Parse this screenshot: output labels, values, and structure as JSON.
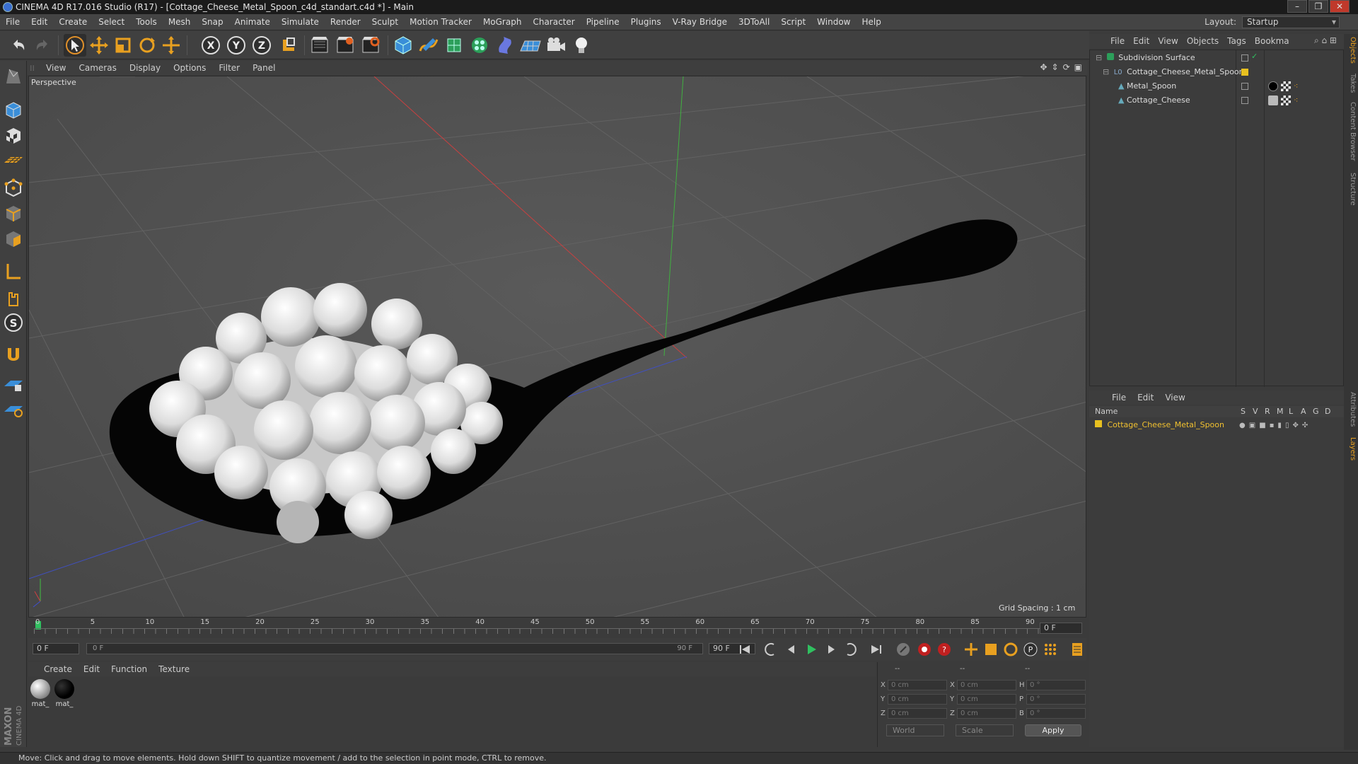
{
  "window": {
    "title": "CINEMA 4D R17.016 Studio (R17) - [Cottage_Cheese_Metal_Spoon_c4d_standart.c4d *] - Main",
    "controls": [
      "–",
      "❐",
      "✕"
    ]
  },
  "menubar": {
    "items": [
      "File",
      "Edit",
      "Create",
      "Select",
      "Tools",
      "Mesh",
      "Snap",
      "Animate",
      "Simulate",
      "Render",
      "Sculpt",
      "Motion Tracker",
      "MoGraph",
      "Character",
      "Pipeline",
      "Plugins",
      "V-Ray Bridge",
      "3DToAll",
      "Script",
      "Window",
      "Help"
    ],
    "layout_label": "Layout:",
    "layout_value": "Startup"
  },
  "toolbar": {
    "icons": [
      "undo-icon",
      "redo-icon",
      "select-arrow-icon",
      "move-icon",
      "scale-icon",
      "rotate-icon",
      "multi-transform-icon",
      "x-axis-icon",
      "y-axis-icon",
      "z-axis-icon",
      "world-coordinate-icon",
      "render-view-icon",
      "render-picture-viewer-icon",
      "render-settings-icon",
      "cube-icon",
      "pen-spline-icon",
      "subdivision-icon",
      "cloner-icon",
      "deformer-icon",
      "floor-icon",
      "camera-icon",
      "light-icon"
    ],
    "axis_labels": [
      "X",
      "Y",
      "Z"
    ]
  },
  "left_toolbar": {
    "icons": [
      "make-editable-icon",
      "model-mode-icon",
      "texture-mode-icon",
      "workplane-icon",
      "points-mode-icon",
      "edges-mode-icon",
      "polygons-mode-icon",
      "axis-mode-icon",
      "tweak-mode-icon",
      "solo-icon",
      "snap-icon",
      "lock-workplane-icon",
      "planar-workplane-icon"
    ],
    "solo_label": "S"
  },
  "viewport": {
    "menu": [
      "View",
      "Cameras",
      "Display",
      "Options",
      "Filter",
      "Panel"
    ],
    "label": "Perspective",
    "grid_spacing": "Grid Spacing : 1 cm"
  },
  "timeline": {
    "ticks": [
      "0",
      "5",
      "10",
      "15",
      "20",
      "25",
      "30",
      "35",
      "40",
      "45",
      "50",
      "55",
      "60",
      "65",
      "70",
      "75",
      "80",
      "85",
      "90"
    ],
    "current_frame": "0 F",
    "start_field": "0 F",
    "range_start": "0 F",
    "range_end": "90 F",
    "end_field": "90 F"
  },
  "material_manager": {
    "menu": [
      "Create",
      "Edit",
      "Function",
      "Texture"
    ],
    "materials": [
      {
        "name": "mat_"
      },
      {
        "name": "mat_"
      }
    ]
  },
  "coordinates": {
    "header": [
      "--",
      "--",
      "--"
    ],
    "rows": [
      {
        "a_label": "X",
        "a_val": "0 cm",
        "b_label": "X",
        "b_val": "0 cm",
        "c_label": "H",
        "c_val": "0 °"
      },
      {
        "a_label": "Y",
        "a_val": "0 cm",
        "b_label": "Y",
        "b_val": "0 cm",
        "c_label": "P",
        "c_val": "0 °"
      },
      {
        "a_label": "Z",
        "a_val": "0 cm",
        "b_label": "Z",
        "b_val": "0 cm",
        "c_label": "B",
        "c_val": "0 °"
      }
    ],
    "space": "World",
    "mode": "Scale",
    "apply_label": "Apply"
  },
  "object_manager": {
    "menu": [
      "File",
      "Edit",
      "View",
      "Objects",
      "Tags",
      "Bookma"
    ],
    "objects": [
      {
        "name": "Subdivision Surface",
        "indent": 0
      },
      {
        "name": "Cottage_Cheese_Metal_Spoon",
        "indent": 1
      },
      {
        "name": "Metal_Spoon",
        "indent": 2
      },
      {
        "name": "Cottage_Cheese",
        "indent": 2
      }
    ]
  },
  "layer_manager": {
    "menu": [
      "File",
      "Edit",
      "View"
    ],
    "columns": [
      "Name",
      "S",
      "V",
      "R",
      "M",
      "L",
      "A",
      "G",
      "D"
    ],
    "layers": [
      {
        "name": "Cottage_Cheese_Metal_Spoon",
        "color": "#e8c020"
      }
    ]
  },
  "side_tabs": [
    "Objects",
    "Takes",
    "Content Browser",
    "Structure",
    "Attributes",
    "Layers"
  ],
  "status": {
    "text": "Move: Click and drag to move elements. Hold down SHIFT to quantize movement / add to the selection in point mode, CTRL to remove."
  },
  "branding": {
    "line1": "MAXON",
    "line2": "CINEMA 4D"
  },
  "colors": {
    "accent": "#e8a020",
    "layer_text": "#f0c030",
    "x_axis": "#d04040",
    "y_axis": "#40c040",
    "z_axis": "#4050d0"
  }
}
